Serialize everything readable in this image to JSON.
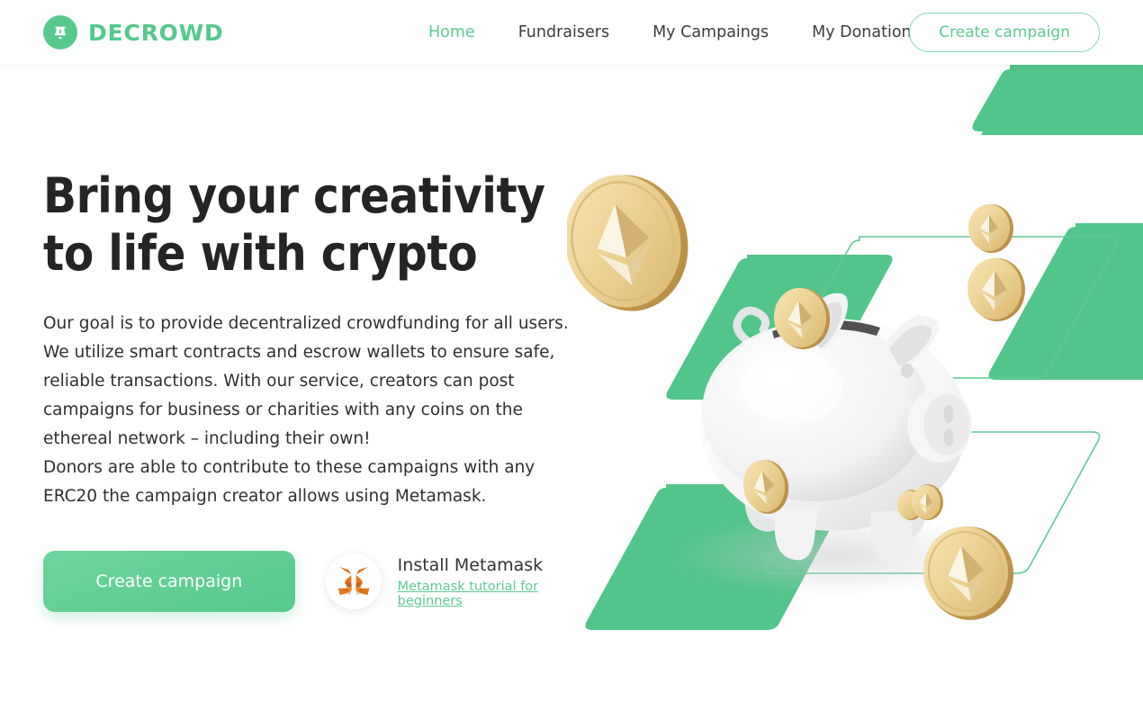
{
  "brand": {
    "name": "DECROWD",
    "logo_icon": "bell-icon",
    "color": "#55c88c"
  },
  "header": {
    "nav": [
      {
        "label": "Home",
        "active": true
      },
      {
        "label": "Fundraisers",
        "active": false
      },
      {
        "label": "My Campaings",
        "active": false
      },
      {
        "label": "My Donations",
        "active": false
      }
    ],
    "cta_label": "Create campaign"
  },
  "hero": {
    "headline": "Bring your creativity to life with crypto",
    "body": "Our goal is to provide decentralized crowdfunding for all users. We utilize smart contracts and escrow wallets to ensure safe, reliable transactions. With our service, creators can post campaigns for business or charities with any coins on the ethereal network – including their own!\nDonors are able to contribute to these campaigns with any ERC20 the campaign creator allows using Metamask.",
    "primary_button_label": "Create campaign",
    "metamask": {
      "icon": "metamask-fox-icon",
      "title": "Install Metamask",
      "link_label": "Metamask tutorial for beginners"
    }
  },
  "illustration": {
    "description": "piggy-bank-with-ethereum-coins",
    "accent_color": "#52c58a",
    "outline_color": "#5fc992",
    "coin_color": "#e9c986"
  }
}
